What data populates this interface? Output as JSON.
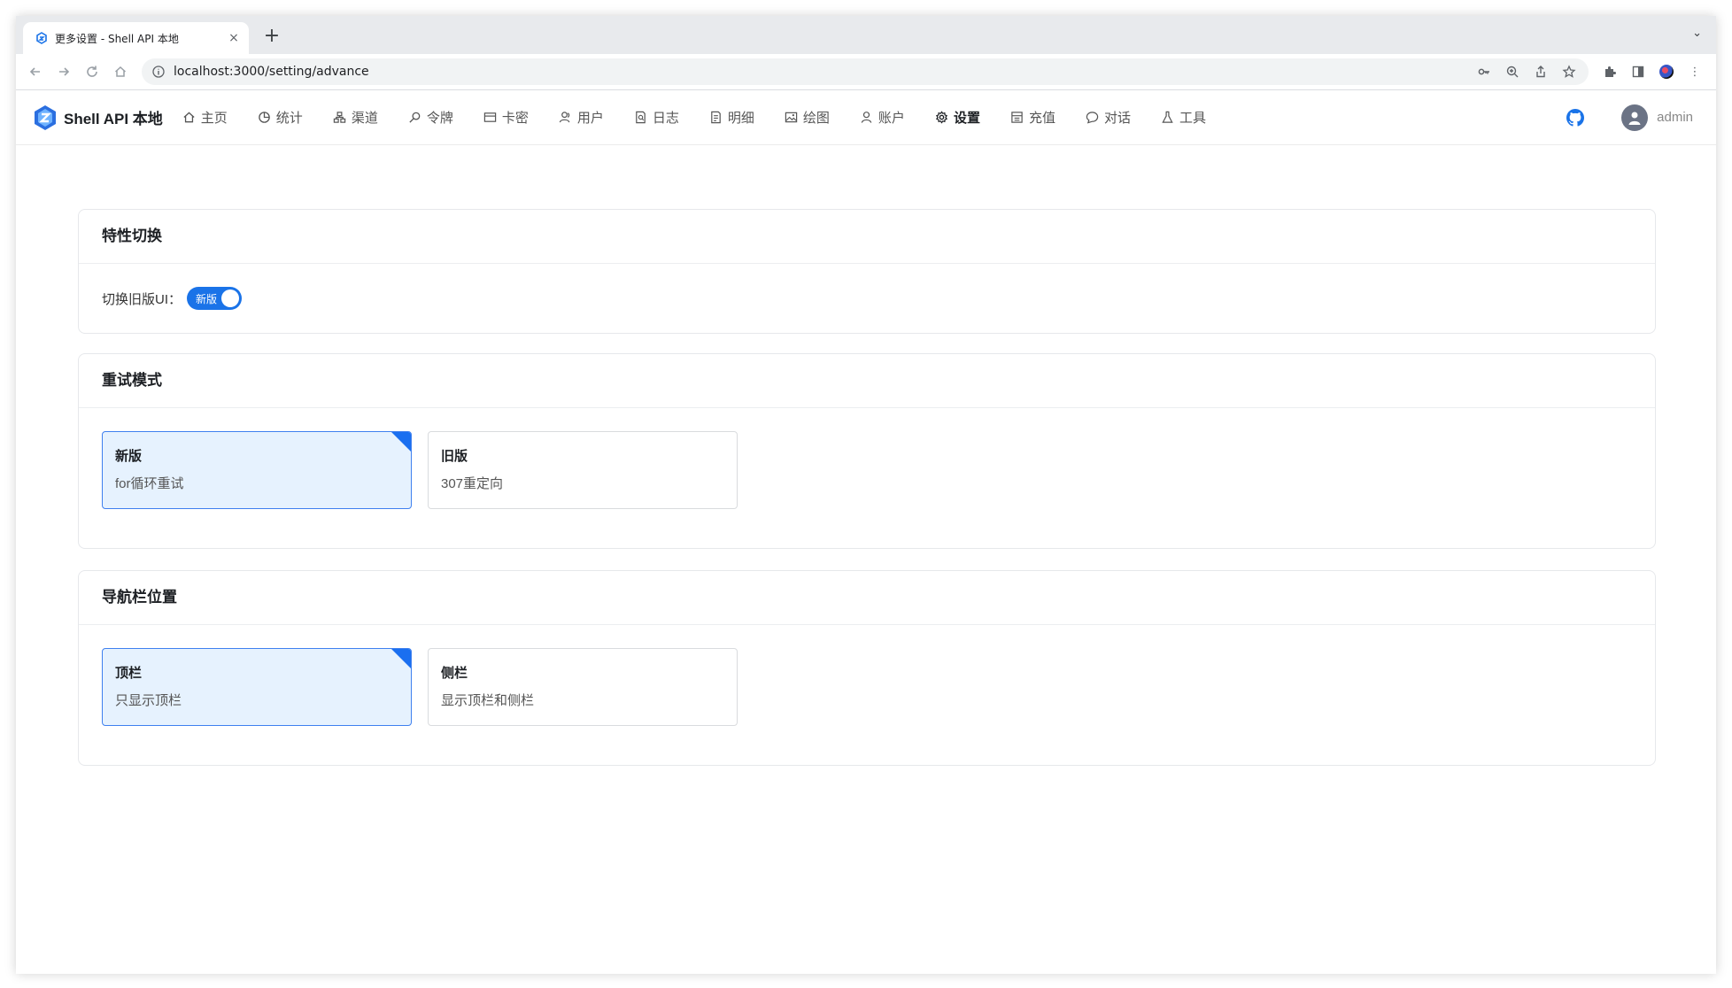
{
  "browser": {
    "tab_title": "更多设置 - Shell API 本地",
    "tab_close": "×",
    "new_tab": "+",
    "url": "localhost:3000/setting/advance"
  },
  "header": {
    "brand": "Shell API 本地",
    "nav": [
      {
        "label": "主页",
        "icon": "home-icon"
      },
      {
        "label": "统计",
        "icon": "pie-chart-icon"
      },
      {
        "label": "渠道",
        "icon": "sitemap-icon"
      },
      {
        "label": "令牌",
        "icon": "key-icon"
      },
      {
        "label": "卡密",
        "icon": "card-icon"
      },
      {
        "label": "用户",
        "icon": "users-icon"
      },
      {
        "label": "日志",
        "icon": "log-icon"
      },
      {
        "label": "明细",
        "icon": "detail-icon"
      },
      {
        "label": "绘图",
        "icon": "image-icon"
      },
      {
        "label": "账户",
        "icon": "account-icon"
      },
      {
        "label": "设置",
        "icon": "gear-icon"
      },
      {
        "label": "充值",
        "icon": "wallet-icon"
      },
      {
        "label": "对话",
        "icon": "chat-icon"
      },
      {
        "label": "工具",
        "icon": "flask-icon"
      }
    ],
    "active_nav": "设置",
    "username": "admin"
  },
  "feature_toggle": {
    "title": "特性切换",
    "label": "切换旧版UI：",
    "switch_text": "新版",
    "switch_on": true
  },
  "retry_mode": {
    "title": "重试模式",
    "options": [
      {
        "title": "新版",
        "desc": "for循环重试",
        "selected": true
      },
      {
        "title": "旧版",
        "desc": "307重定向",
        "selected": false
      }
    ]
  },
  "nav_position": {
    "title": "导航栏位置",
    "options": [
      {
        "title": "顶栏",
        "desc": "只显示顶栏",
        "selected": true
      },
      {
        "title": "侧栏",
        "desc": "显示顶栏和侧栏",
        "selected": false
      }
    ]
  },
  "colors": {
    "accent": "#1a73e8",
    "selected_bg": "#e6f2fe",
    "selected_border": "#3f80ef"
  }
}
